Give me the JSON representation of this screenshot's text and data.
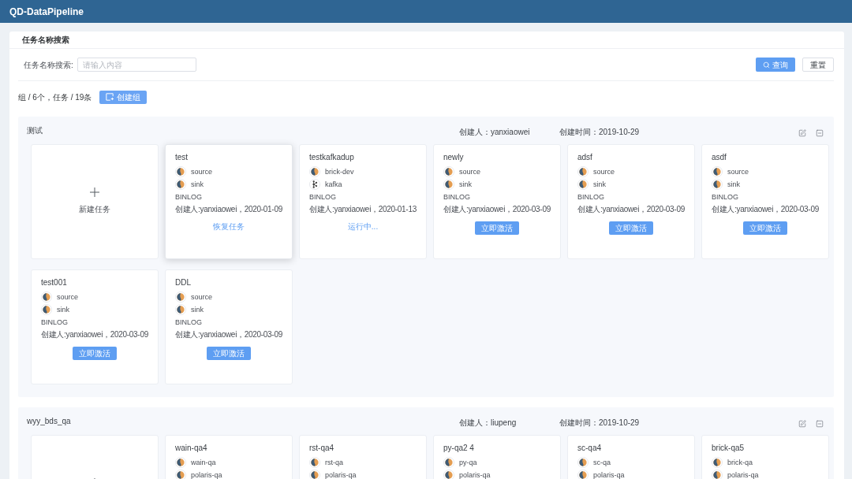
{
  "header": {
    "title": "QD-DataPipeline"
  },
  "search_panel": {
    "title": "任务名称搜索",
    "field": {
      "label": "任务名称搜索:",
      "placeholder": "请输入内容"
    },
    "buttons": [
      {
        "kind": "primary",
        "label": "查询"
      },
      {
        "kind": "default",
        "label": "重置"
      }
    ]
  },
  "summary": {
    "text": "组 / 6个，任务 / 19条",
    "create_button": "创建组"
  },
  "groups": [
    {
      "name": "测试",
      "creator": "创建人：yanxiaowei",
      "created_time": "创建时间：2019-10-29",
      "cards": [
        {
          "kind": "new",
          "label": "新建任务"
        },
        {
          "kind": "task",
          "name": "test",
          "selected": true,
          "endpoints": [
            {
              "kind": "db",
              "name": "source"
            },
            {
              "kind": "db",
              "name": "sink"
            }
          ],
          "type": "BINLOG",
          "meta": "创建人:yanxiaowei，2020-01-09",
          "action": {
            "kind": "link",
            "label": "恢复任务"
          }
        },
        {
          "kind": "task",
          "name": "testkafkadup",
          "selected": false,
          "endpoints": [
            {
              "kind": "db",
              "name": "brick-dev"
            },
            {
              "kind": "kafka",
              "name": "kafka"
            }
          ],
          "type": "BINLOG",
          "meta": "创建人:yanxiaowei，2020-01-13",
          "action": {
            "kind": "status",
            "label": "运行中..."
          }
        },
        {
          "kind": "task",
          "name": "newly",
          "selected": false,
          "endpoints": [
            {
              "kind": "db",
              "name": "source"
            },
            {
              "kind": "db",
              "name": "sink"
            }
          ],
          "type": "BINLOG",
          "meta": "创建人:yanxiaowei，2020-03-09",
          "action": {
            "kind": "button",
            "label": "立即激活"
          }
        },
        {
          "kind": "task",
          "name": "adsf",
          "selected": false,
          "endpoints": [
            {
              "kind": "db",
              "name": "source"
            },
            {
              "kind": "db",
              "name": "sink"
            }
          ],
          "type": "BINLOG",
          "meta": "创建人:yanxiaowei，2020-03-09",
          "action": {
            "kind": "button",
            "label": "立即激活"
          }
        },
        {
          "kind": "task",
          "name": "asdf",
          "selected": false,
          "endpoints": [
            {
              "kind": "db",
              "name": "source"
            },
            {
              "kind": "db",
              "name": "sink"
            }
          ],
          "type": "BINLOG",
          "meta": "创建人:yanxiaowei，2020-03-09",
          "action": {
            "kind": "button",
            "label": "立即激活"
          }
        },
        {
          "kind": "task",
          "name": "test001",
          "selected": false,
          "endpoints": [
            {
              "kind": "db",
              "name": "source"
            },
            {
              "kind": "db",
              "name": "sink"
            }
          ],
          "type": "BINLOG",
          "meta": "创建人:yanxiaowei，2020-03-09",
          "action": {
            "kind": "button",
            "label": "立即激活"
          }
        },
        {
          "kind": "task",
          "name": "DDL",
          "selected": false,
          "endpoints": [
            {
              "kind": "db",
              "name": "source"
            },
            {
              "kind": "db",
              "name": "sink"
            }
          ],
          "type": "BINLOG",
          "meta": "创建人:yanxiaowei，2020-03-09",
          "action": {
            "kind": "button",
            "label": "立即激活"
          }
        }
      ]
    },
    {
      "name": "wyy_bds_qa",
      "creator": "创建人：liupeng",
      "created_time": "创建时间：2019-10-29",
      "cards": [
        {
          "kind": "new"
        },
        {
          "kind": "task",
          "name": "wain-qa4",
          "selected": false,
          "endpoints": [
            {
              "kind": "db",
              "name": "wain-qa"
            },
            {
              "kind": "db",
              "name": "polaris-qa"
            }
          ]
        },
        {
          "kind": "task",
          "name": "rst-qa4",
          "selected": false,
          "endpoints": [
            {
              "kind": "db",
              "name": "rst-qa"
            },
            {
              "kind": "db",
              "name": "polaris-qa"
            }
          ]
        },
        {
          "kind": "task",
          "name": "py-qa2 4",
          "selected": false,
          "endpoints": [
            {
              "kind": "db",
              "name": "py-qa"
            },
            {
              "kind": "db",
              "name": "polaris-qa"
            }
          ]
        },
        {
          "kind": "task",
          "name": "sc-qa4",
          "selected": false,
          "endpoints": [
            {
              "kind": "db",
              "name": "sc-qa"
            },
            {
              "kind": "db",
              "name": "polaris-qa"
            }
          ]
        },
        {
          "kind": "task",
          "name": "brick-qa5",
          "selected": false,
          "endpoints": [
            {
              "kind": "db",
              "name": "brick-qa"
            },
            {
              "kind": "db",
              "name": "polaris-qa"
            }
          ]
        }
      ]
    }
  ]
}
